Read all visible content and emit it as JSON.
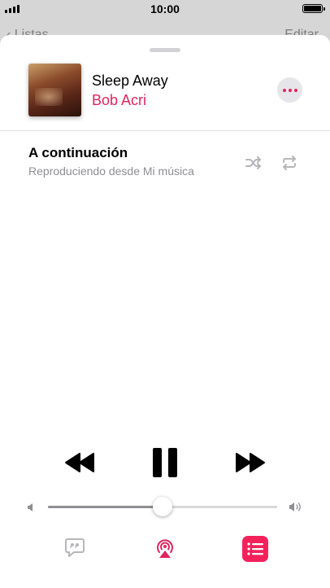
{
  "status_bar": {
    "time": "10:00"
  },
  "background_nav": {
    "back_label": "Listas",
    "edit_label": "Editar"
  },
  "now_playing": {
    "title": "Sleep Away",
    "artist": "Bob Acri"
  },
  "up_next": {
    "title": "A continuación",
    "subtitle": "Reproduciendo desde Mi música"
  },
  "playback": {
    "state": "playing",
    "volume_fraction": 0.5
  },
  "colors": {
    "accent": "#e0245e",
    "queue_button": "#f4215b",
    "secondary_text": "#8e8e93"
  },
  "icons": {
    "more": "ellipsis-icon",
    "shuffle": "shuffle-icon",
    "repeat": "repeat-icon",
    "rewind": "rewind-icon",
    "pause": "pause-icon",
    "forward": "fast-forward-icon",
    "lyrics": "lyrics-icon",
    "airplay": "airplay-icon",
    "queue": "queue-list-icon"
  }
}
